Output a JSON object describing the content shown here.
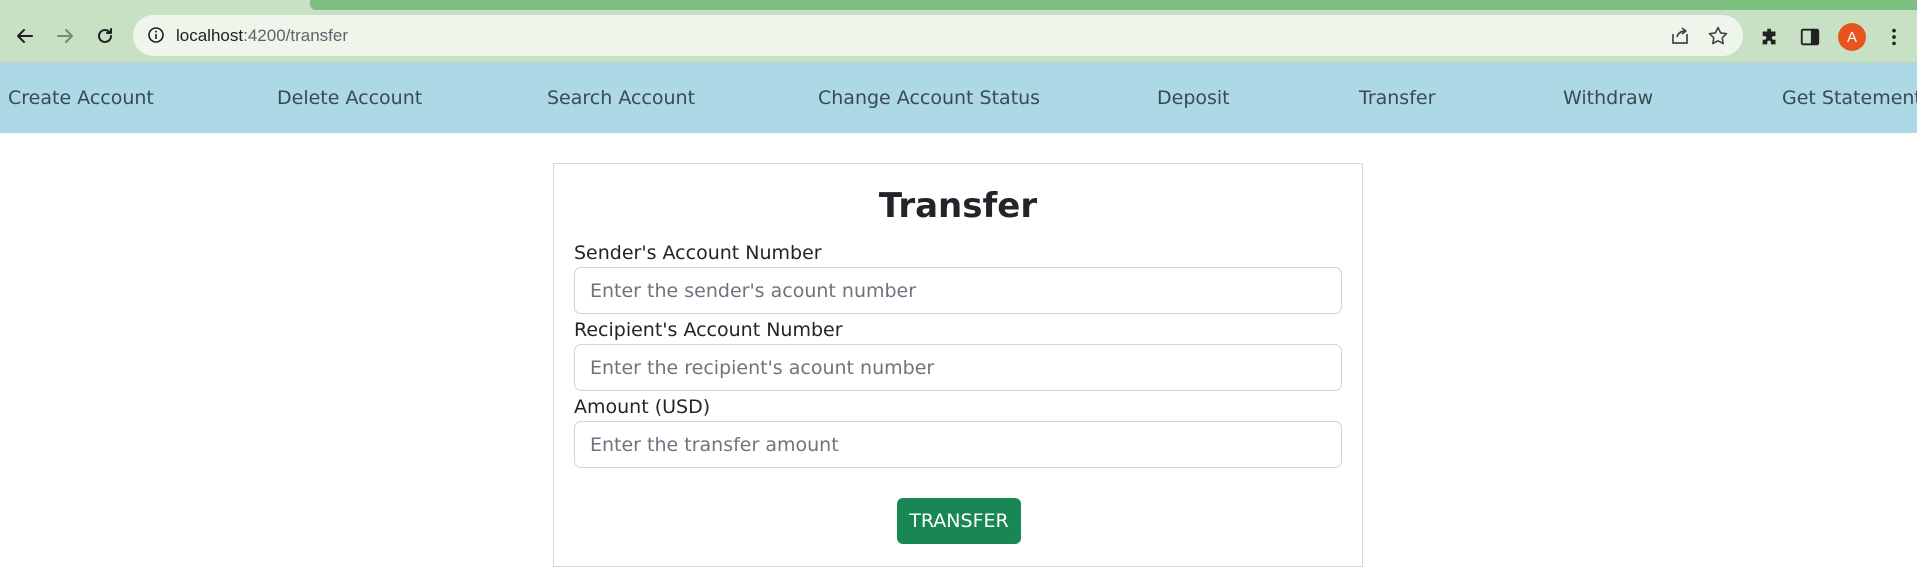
{
  "browser": {
    "url_host": "localhost",
    "url_path": ":4200/transfer",
    "profile_initial": "A",
    "colors": {
      "chrome": "#c8e0c4",
      "omnibox": "#eef6ec",
      "avatar": "#e8541f"
    }
  },
  "nav": {
    "items": [
      "Create Account",
      "Delete Account",
      "Search Account",
      "Change Account Status",
      "Deposit",
      "Transfer",
      "Withdraw",
      "Get Statement"
    ],
    "background": "#add8e6"
  },
  "form": {
    "title": "Transfer",
    "fields": [
      {
        "label": "Sender's Account Number",
        "placeholder": "Enter the sender's acount number",
        "value": ""
      },
      {
        "label": "Recipient's Account Number",
        "placeholder": "Enter the recipient's acount number",
        "value": ""
      },
      {
        "label": "Amount (USD)",
        "placeholder": "Enter the transfer amount",
        "value": ""
      }
    ],
    "submit_label": "TRANSFER",
    "submit_color": "#198754"
  }
}
